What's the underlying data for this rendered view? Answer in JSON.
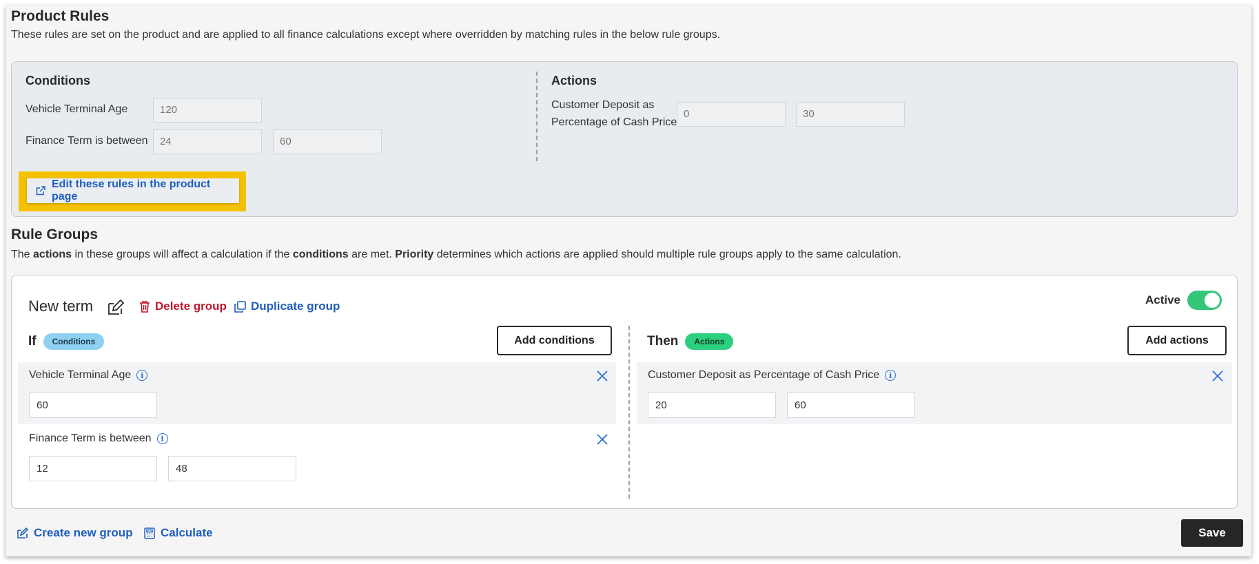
{
  "product_rules": {
    "title": "Product Rules",
    "description": "These rules are set on the product and are applied to all finance calculations except where overridden by matching rules in the below rule groups.",
    "conditions_heading": "Conditions",
    "actions_heading": "Actions",
    "conditions": [
      {
        "label": "Vehicle Terminal Age",
        "values": [
          "120"
        ]
      },
      {
        "label": "Finance Term is between",
        "values": [
          "24",
          "60"
        ]
      }
    ],
    "actions": [
      {
        "label_line1": "Customer Deposit as",
        "label_line2": "Percentage of Cash Price",
        "values": [
          "0",
          "30"
        ]
      }
    ],
    "edit_link": "Edit these rules in the product page"
  },
  "rule_groups": {
    "title": "Rule Groups",
    "desc_parts": [
      "The ",
      "actions",
      " in these groups will affect a calculation if the ",
      "conditions",
      " are met. ",
      "Priority",
      " determines which actions are applied should multiple rule groups apply to the same calculation."
    ],
    "group": {
      "name": "New term",
      "delete_label": "Delete group",
      "duplicate_label": "Duplicate group",
      "active_label": "Active",
      "active": true,
      "if_label": "If",
      "conditions_badge": "Conditions",
      "then_label": "Then",
      "actions_badge": "Actions",
      "add_conditions_label": "Add conditions",
      "add_actions_label": "Add actions",
      "conditions": [
        {
          "label": "Vehicle Terminal Age",
          "values": [
            "60"
          ]
        },
        {
          "label": "Finance Term is between",
          "values": [
            "12",
            "48"
          ]
        }
      ],
      "actions": [
        {
          "label": "Customer Deposit as Percentage of Cash Price",
          "values": [
            "20",
            "60"
          ]
        }
      ]
    }
  },
  "footer": {
    "create_group_label": "Create new group",
    "calculate_label": "Calculate",
    "save_label": "Save"
  },
  "colors": {
    "link_blue": "#1f5fbf",
    "delete_red": "#c0182e",
    "highlight": "#f5c200",
    "toggle_on": "#34c77b"
  }
}
